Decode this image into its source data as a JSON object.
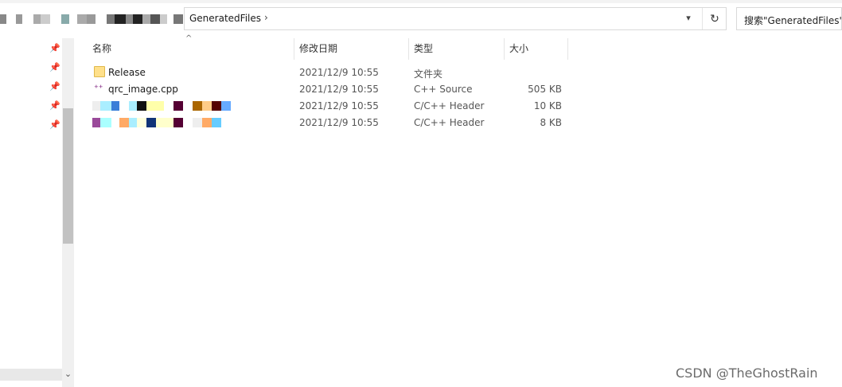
{
  "address": {
    "crumb": "GeneratedFiles",
    "chevron": "›",
    "dropdown_icon": "chevron-down-icon",
    "refresh_icon": "refresh-icon"
  },
  "search": {
    "placeholder": "搜索\"GeneratedFiles\""
  },
  "columns": {
    "name": "名称",
    "modified": "修改日期",
    "type": "类型",
    "size": "大小"
  },
  "files": [
    {
      "name": "Release",
      "date": "2021/12/9 10:55",
      "type": "文件夹",
      "size": "",
      "icon": "folder-icon"
    },
    {
      "name": "qrc_image.cpp",
      "date": "2021/12/9 10:55",
      "type": "C++ Source",
      "size": "505 KB",
      "icon": "cpp-file-icon"
    },
    {
      "name": "",
      "date": "2021/12/9 10:55",
      "type": "C/C++ Header",
      "size": "10 KB",
      "icon": "header-file-icon"
    },
    {
      "name": "",
      "date": "2021/12/9 10:55",
      "type": "C/C++ Header",
      "size": "8 KB",
      "icon": "header-file-icon"
    }
  ],
  "watermark": "CSDN @TheGhostRain",
  "colors": {
    "folder": "#ffe08a",
    "cpp_icon": "#8e3b8f",
    "scroll_thumb": "#c2c2c2"
  }
}
